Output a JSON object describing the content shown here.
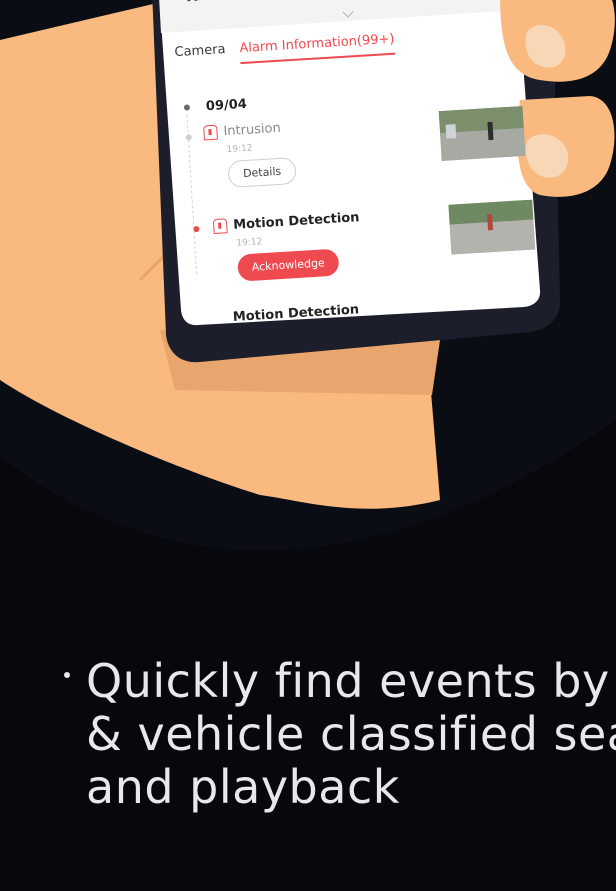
{
  "tabs": {
    "camera": "Camera",
    "alarm": "Alarm Information(99+)"
  },
  "alarm_list": {
    "date": "09/04",
    "events": [
      {
        "title": "Intrusion",
        "time": "19:12",
        "button": "Details"
      },
      {
        "title": "Motion Detection",
        "time": "19:12",
        "button": "Acknowledge"
      },
      {
        "title": "Motion Detection"
      }
    ]
  },
  "promo": {
    "line1": "Quickly find events by",
    "line2": "& vehicle classified sea",
    "line3": "and playback"
  },
  "colors": {
    "background": "#0b0d14",
    "skin": "#f9b97f",
    "phone_body": "#1c1f2b",
    "accent": "#ee4a4f"
  },
  "icons": {
    "topbar": [
      "pause-icon",
      "mute-icon",
      "screen-icon"
    ],
    "event": "alarm-bell-icon"
  }
}
